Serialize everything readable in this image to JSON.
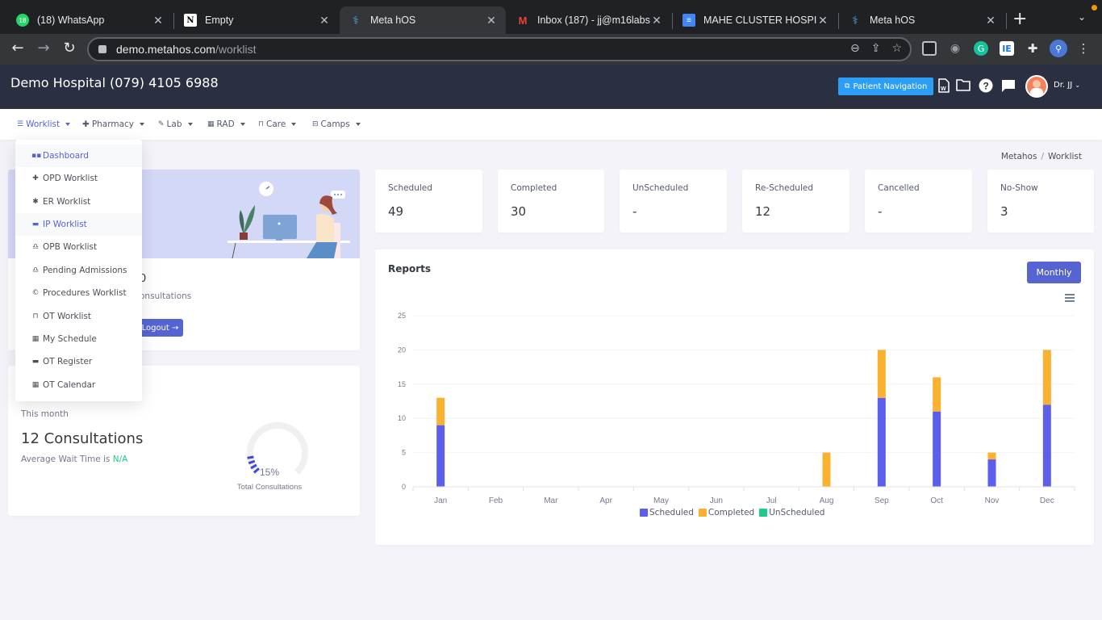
{
  "browser": {
    "tabs": [
      {
        "title": "(18) WhatsApp",
        "icon": "whatsapp-icon",
        "badge": "18",
        "active": false
      },
      {
        "title": "Empty",
        "icon": "notion-icon",
        "active": false
      },
      {
        "title": "Meta hOS",
        "icon": "stethoscope-icon",
        "active": true
      },
      {
        "title": "Inbox (187) - jj@m16labs.",
        "icon": "gmail-icon",
        "active": false
      },
      {
        "title": "MAHE CLUSTER HOSPITA",
        "icon": "google-docs-icon",
        "active": false
      },
      {
        "title": "Meta hOS",
        "icon": "stethoscope-icon",
        "active": false
      }
    ],
    "url_host": "demo.metahos.com",
    "url_path": "/worklist"
  },
  "header": {
    "hospital_title": "Demo Hospital (079) 4105 6988",
    "patient_navigation_label": "Patient Navigation",
    "user_name": "Dr. JJ"
  },
  "topnav": {
    "items": [
      {
        "label": "Worklist",
        "icon": "list-icon",
        "active": true
      },
      {
        "label": "Pharmacy",
        "icon": "plus-icon"
      },
      {
        "label": "Lab",
        "icon": "pencil-icon"
      },
      {
        "label": "RAD",
        "icon": "film-icon"
      },
      {
        "label": "Care",
        "icon": "bed-icon"
      },
      {
        "label": "Camps",
        "icon": "briefcase-icon"
      }
    ]
  },
  "dropdown": {
    "items": [
      {
        "label": "Dashboard",
        "icon": "grid-icon",
        "highlight": true
      },
      {
        "label": "OPD Worklist",
        "icon": "plus-icon"
      },
      {
        "label": "ER Worklist",
        "icon": "asterisk-icon"
      },
      {
        "label": "IP Worklist",
        "icon": "bed-icon",
        "highlight": true
      },
      {
        "label": "OPB Worklist",
        "icon": "bell-icon"
      },
      {
        "label": "Pending Admissions",
        "icon": "bell-icon"
      },
      {
        "label": "Procedures Worklist",
        "icon": "copyright-icon"
      },
      {
        "label": "OT Worklist",
        "icon": "bed-outline-icon"
      },
      {
        "label": "My Schedule",
        "icon": "calendar-icon"
      },
      {
        "label": "OT Register",
        "icon": "bed-person-icon"
      },
      {
        "label": "OT Calendar",
        "icon": "calendar-icon"
      }
    ]
  },
  "breadcrumb": {
    "root": "Metahos",
    "current": "Worklist"
  },
  "welcome": {
    "count_partial": "0",
    "subtitle_partial": "onsultations",
    "logout_label": "Logout"
  },
  "monthly_card": {
    "period": "This month",
    "consultations": "12 Consultations",
    "wait_prefix": "Average Wait Time is ",
    "wait_value": "N/A",
    "gauge_percent": 15,
    "gauge_label": "15%",
    "gauge_caption": "Total Consultations"
  },
  "stats": [
    {
      "label": "Scheduled",
      "value": "49"
    },
    {
      "label": "Completed",
      "value": "30"
    },
    {
      "label": "UnScheduled",
      "value": "-"
    },
    {
      "label": "Re-Scheduled",
      "value": "12"
    },
    {
      "label": "Cancelled",
      "value": "-"
    },
    {
      "label": "No-Show",
      "value": "3"
    }
  ],
  "reports": {
    "title": "Reports",
    "period_button": "Monthly"
  },
  "colors": {
    "primary": "#5664d2",
    "scheduled": "#5b5fec",
    "completed": "#fbb130",
    "unscheduled": "#1ccc8c",
    "header_bg": "#2a3042",
    "patient_nav": "#2d9ef5",
    "success_text": "#1ccc8c"
  },
  "chart_data": {
    "type": "bar",
    "stacked": true,
    "title": "Reports",
    "categories": [
      "Jan",
      "Feb",
      "Mar",
      "Apr",
      "May",
      "Jun",
      "Jul",
      "Aug",
      "Sep",
      "Oct",
      "Nov",
      "Dec"
    ],
    "series": [
      {
        "name": "Scheduled",
        "values": [
          9,
          0,
          0,
          0,
          0,
          0,
          0,
          0,
          13,
          11,
          4,
          12
        ]
      },
      {
        "name": "Completed",
        "values": [
          4,
          0,
          0,
          0,
          0,
          0,
          0,
          5,
          7,
          5,
          1,
          8
        ]
      },
      {
        "name": "UnScheduled",
        "values": [
          0,
          0,
          0,
          0,
          0,
          0,
          0,
          0,
          0,
          0,
          0,
          0
        ]
      }
    ],
    "yticks": [
      0,
      5,
      10,
      15,
      20,
      25
    ],
    "ylim": [
      0,
      25
    ],
    "xlabel": "",
    "ylabel": "",
    "grid": true,
    "legend": "bottom-center"
  }
}
